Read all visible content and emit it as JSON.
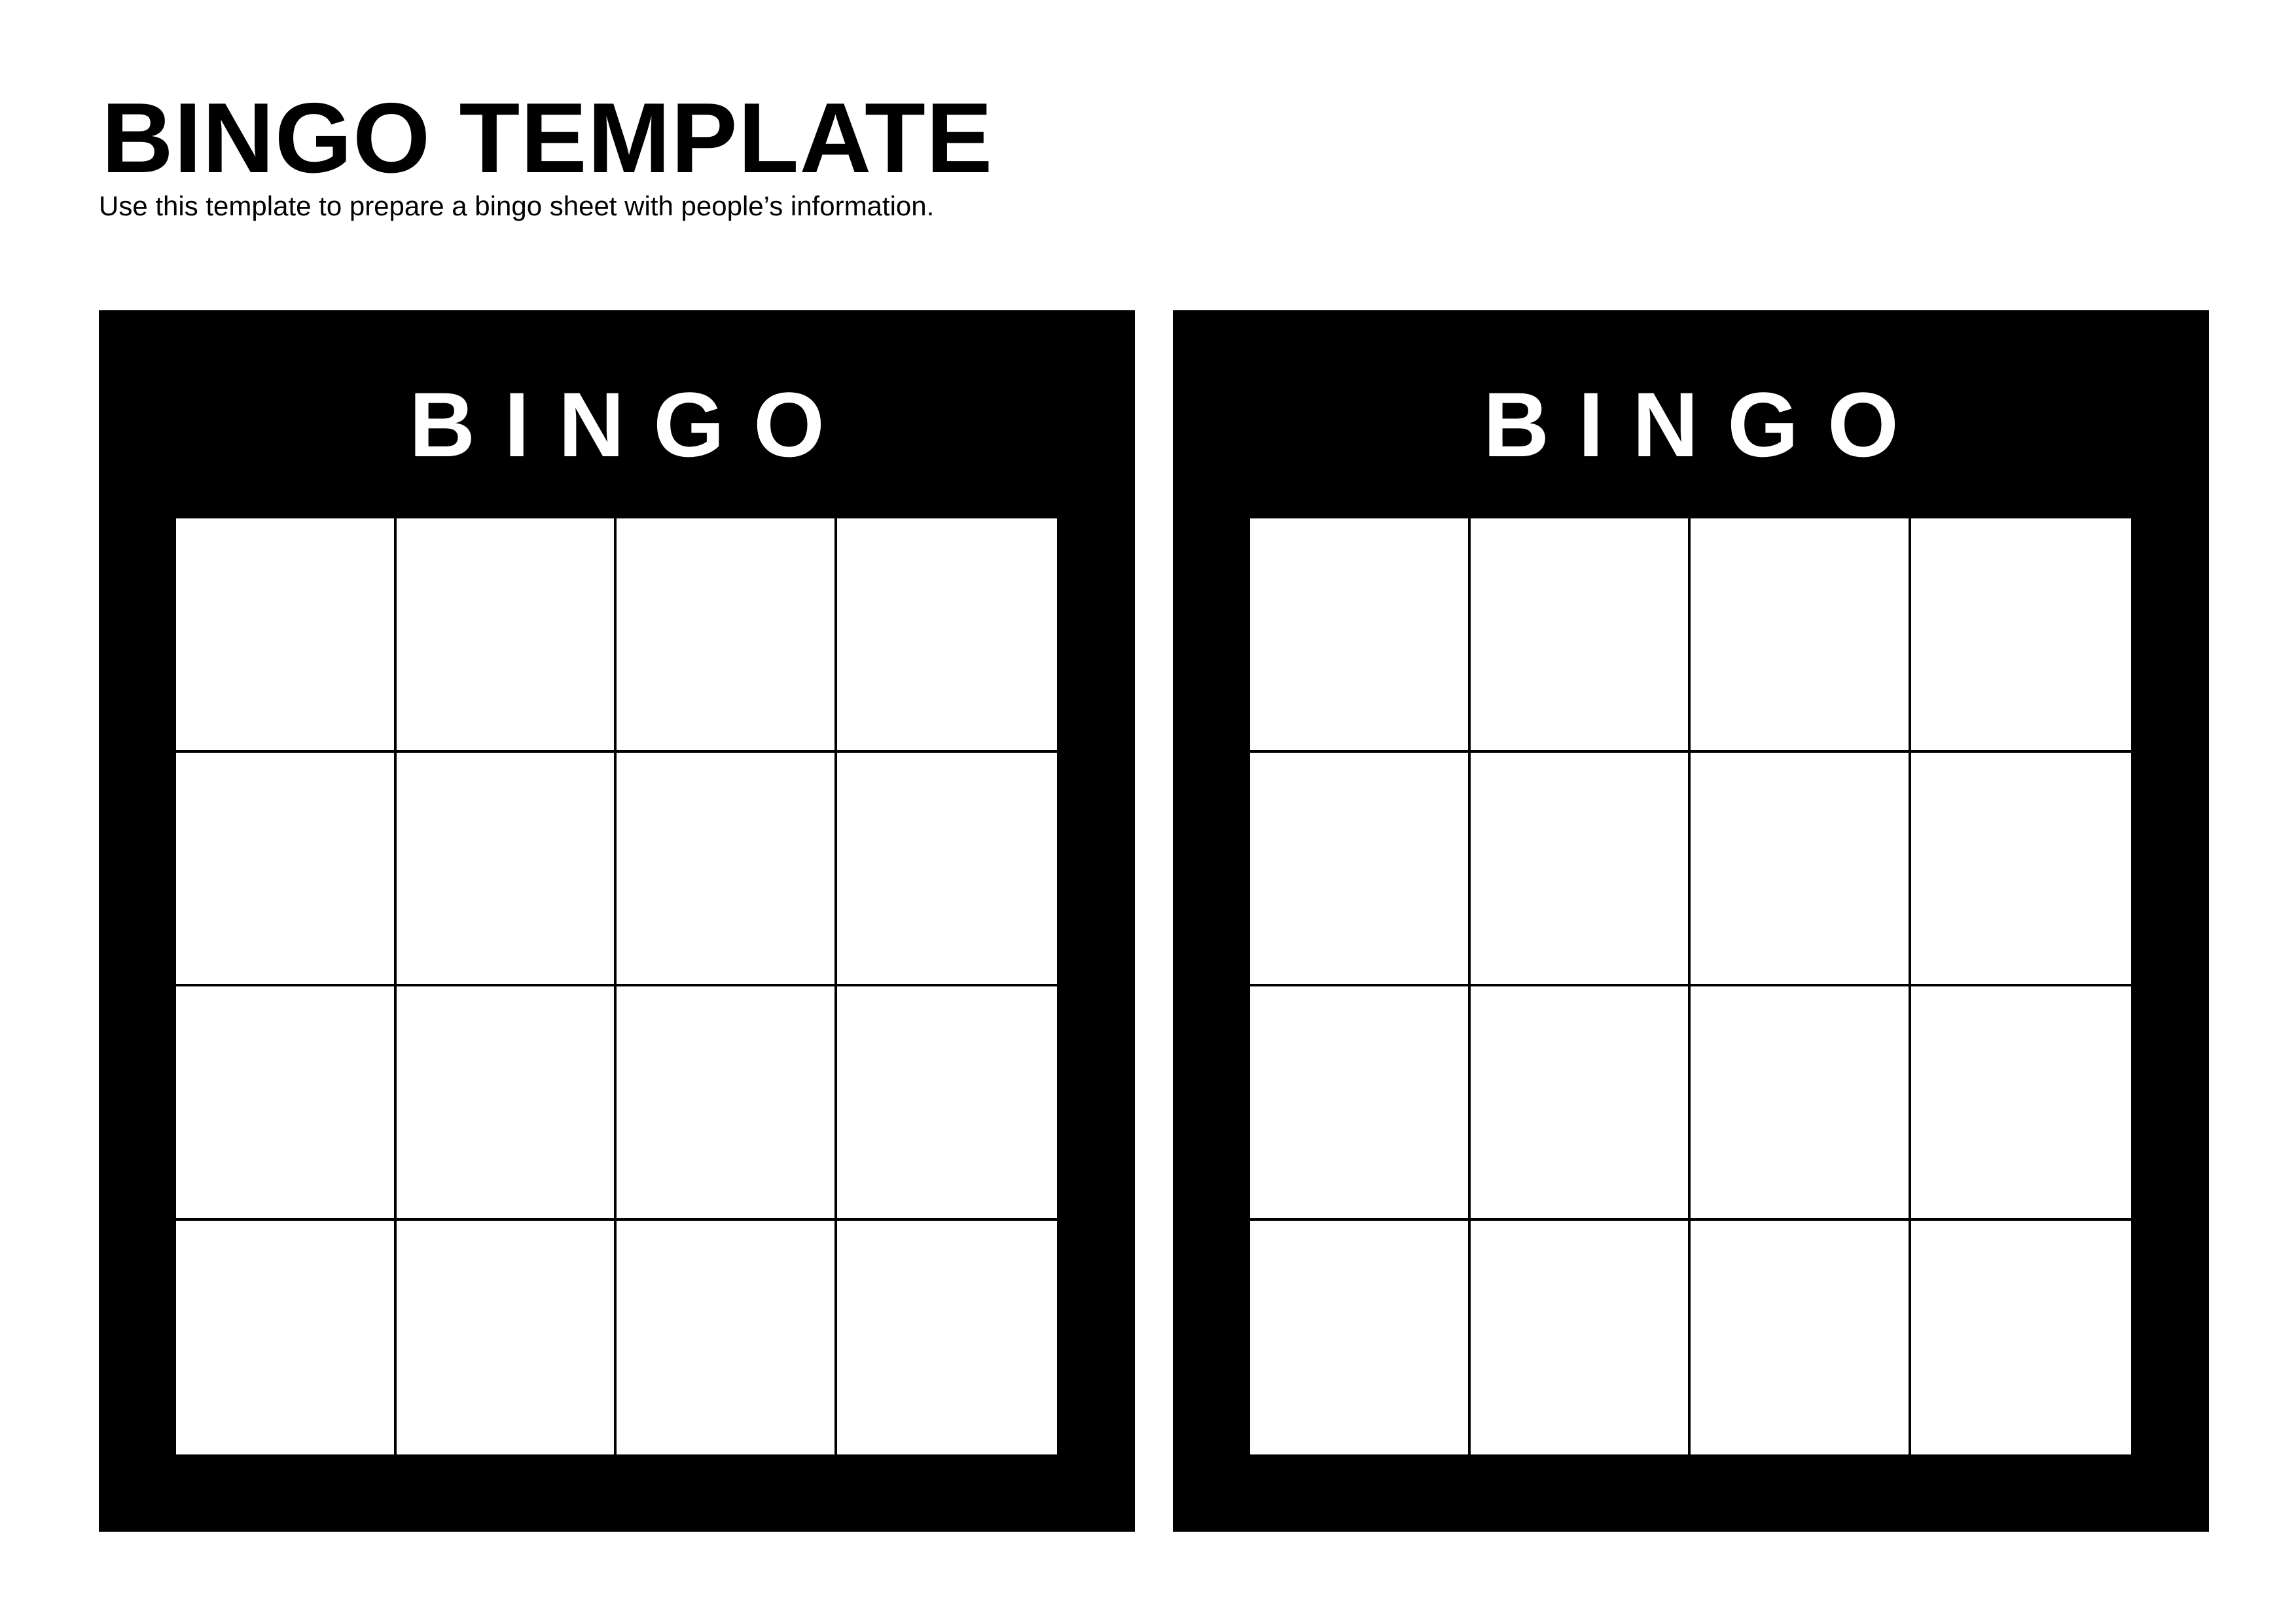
{
  "header": {
    "title": "BINGO TEMPLATE",
    "subtitle": "Use this template to prepare a bingo sheet with people’s information."
  },
  "cards": [
    {
      "heading": "BINGO",
      "rows": 4,
      "columns": 4
    },
    {
      "heading": "BINGO",
      "rows": 4,
      "columns": 4
    }
  ],
  "colors": {
    "card_background": "#000000",
    "cell_background": "#ffffff",
    "text": "#000000",
    "card_heading_text": "#ffffff"
  }
}
